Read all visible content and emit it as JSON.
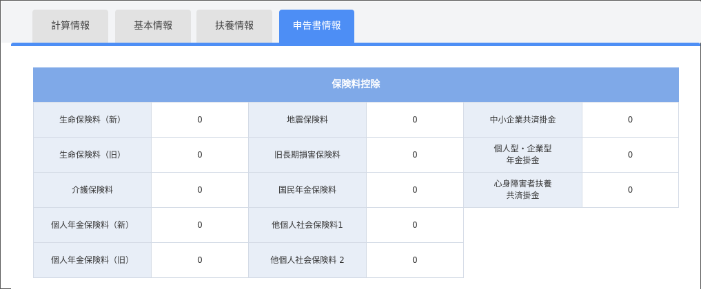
{
  "tabs": [
    {
      "label": "計算情報"
    },
    {
      "label": "基本情報"
    },
    {
      "label": "扶養情報"
    },
    {
      "label": "申告書情報"
    }
  ],
  "accent_color": "#4d8ef5",
  "section": {
    "title": "保険料控除",
    "rows": [
      [
        {
          "label": "生命保険料（新）",
          "value": "0"
        },
        {
          "label": "地震保険料",
          "value": "0"
        },
        {
          "label": "中小企業共済掛金",
          "value": "0"
        }
      ],
      [
        {
          "label": "生命保険料（旧）",
          "value": "0"
        },
        {
          "label": "旧長期損害保険料",
          "value": "0"
        },
        {
          "label": "個人型・企業型\n年金掛金",
          "value": "0"
        }
      ],
      [
        {
          "label": "介護保険料",
          "value": "0"
        },
        {
          "label": "国民年金保険料",
          "value": "0"
        },
        {
          "label": "心身障害者扶養\n共済掛金",
          "value": "0"
        }
      ],
      [
        {
          "label": "個人年金保険料（新）",
          "value": "0"
        },
        {
          "label": "他個人社会保険料1",
          "value": "0"
        }
      ],
      [
        {
          "label": "個人年金保険料（旧）",
          "value": "0"
        },
        {
          "label": "他個人社会保険料 2",
          "value": "0"
        }
      ]
    ]
  }
}
